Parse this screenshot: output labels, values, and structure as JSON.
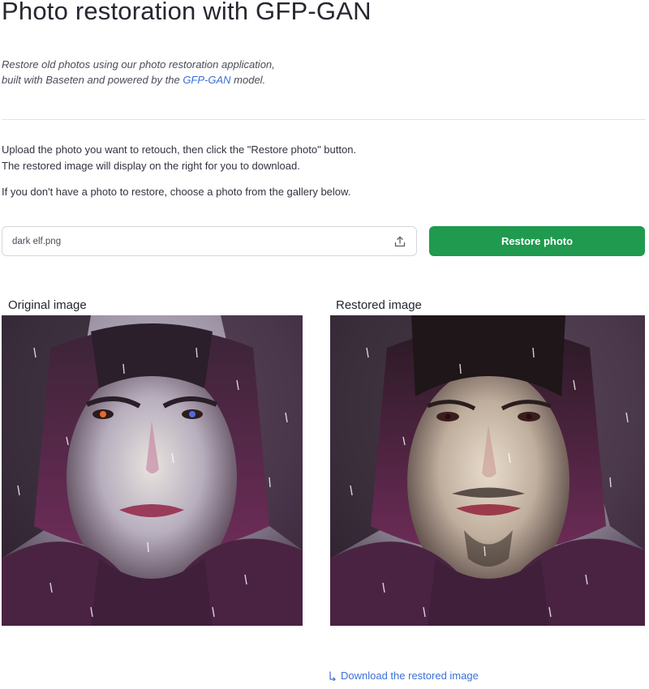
{
  "header": {
    "title": "Photo restoration with GFP-GAN",
    "subtitle_line1": "Restore old photos using our photo restoration application,",
    "subtitle_line2_prefix": "built with Baseten and powered by the ",
    "subtitle_link": "GFP-GAN",
    "subtitle_line2_suffix": " model."
  },
  "instructions": {
    "line1": "Upload the photo you want to retouch, then click the \"Restore photo\" button.",
    "line2": "The restored image will display on the right for you to download.",
    "line3": "If you don't have a photo to restore, choose a photo from the gallery below."
  },
  "uploader": {
    "file_name": "dark elf.png",
    "icon": "upload-icon"
  },
  "actions": {
    "restore_label": "Restore photo",
    "restore_color": "#1f9a4f"
  },
  "images": {
    "original_label": "Original image",
    "restored_label": "Restored image"
  },
  "download": {
    "label": "Download the restored image",
    "icon": "download-arrow-icon",
    "link_color": "#3b6fd8"
  }
}
